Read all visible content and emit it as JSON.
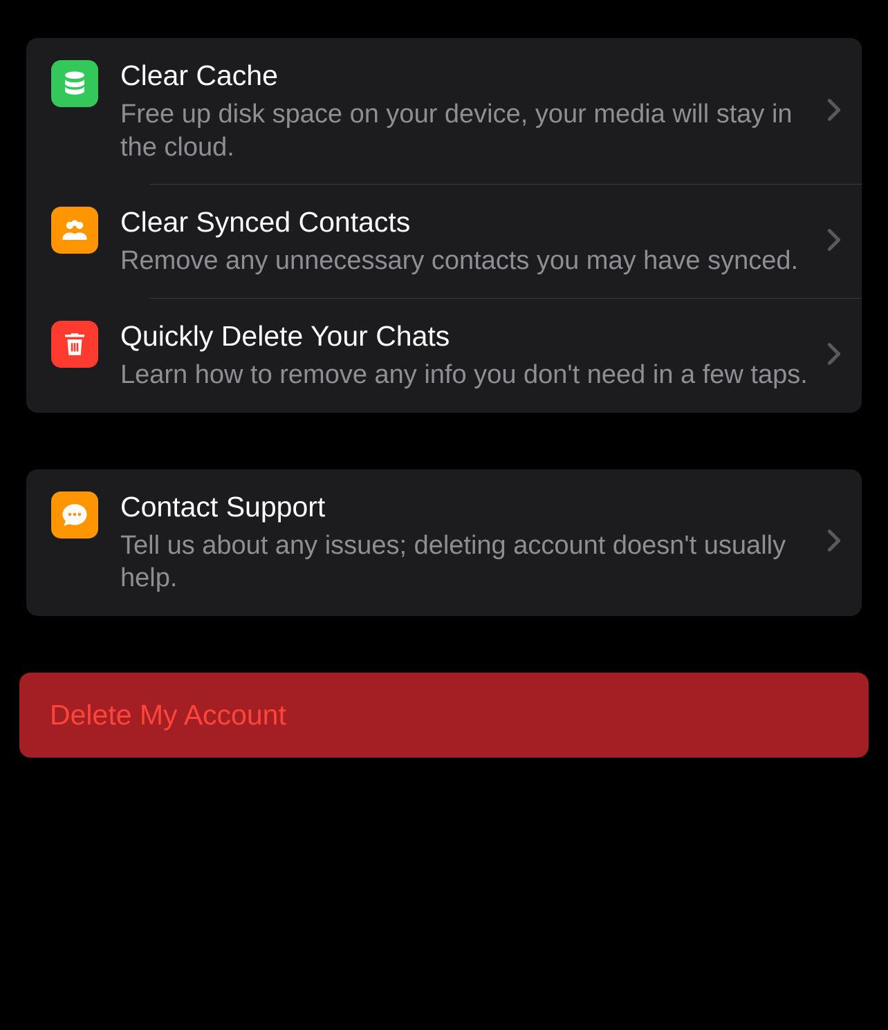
{
  "section1": {
    "items": [
      {
        "icon": "database-icon",
        "iconColor": "green",
        "title": "Clear Cache",
        "subtitle": "Free up disk space on your device, your media will stay in the cloud."
      },
      {
        "icon": "people-icon",
        "iconColor": "orange",
        "title": "Clear Synced Contacts",
        "subtitle": "Remove any unnecessary contacts you may have synced."
      },
      {
        "icon": "trash-icon",
        "iconColor": "red",
        "title": "Quickly Delete Your Chats",
        "subtitle": "Learn how to remove any info you don't need in a few taps."
      }
    ]
  },
  "section2": {
    "items": [
      {
        "icon": "chat-icon",
        "iconColor": "orange",
        "title": "Contact Support",
        "subtitle": "Tell us about any issues; deleting account doesn't usually help."
      }
    ]
  },
  "deleteButton": {
    "label": "Delete My Account"
  }
}
